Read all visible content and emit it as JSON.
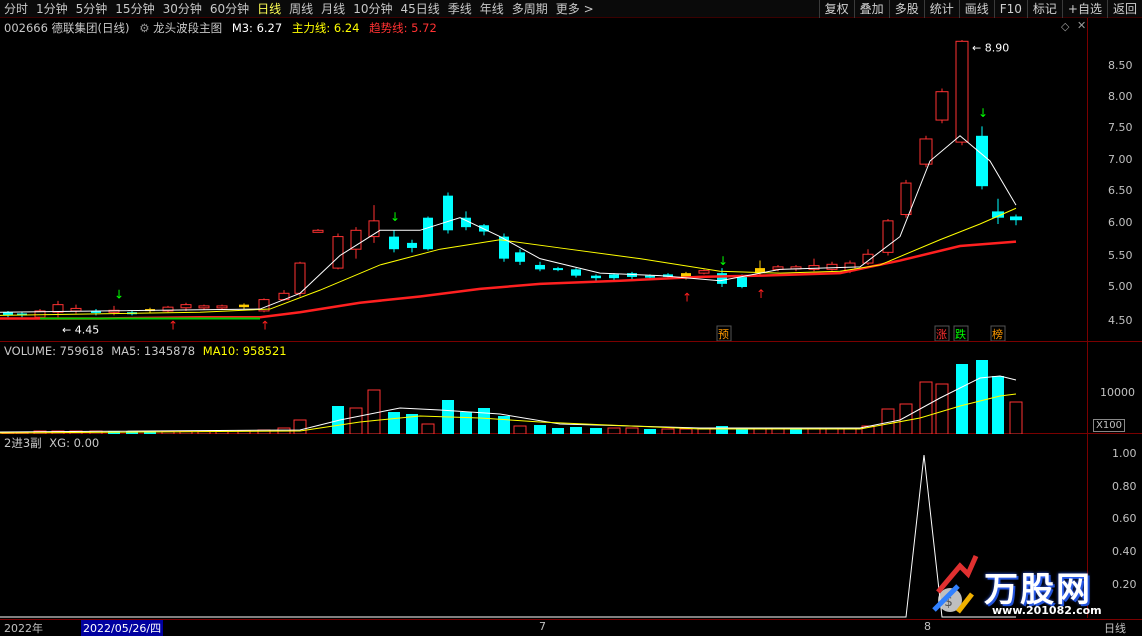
{
  "toolbar": {
    "tabs": [
      "分时",
      "1分钟",
      "5分钟",
      "15分钟",
      "30分钟",
      "60分钟",
      "日线",
      "周线",
      "月线",
      "10分钟",
      "45日线",
      "季线",
      "年线",
      "多周期",
      "更多 >"
    ],
    "active_tab": "日线",
    "right_buttons": [
      "复权",
      "叠加",
      "多股",
      "统计",
      "画线",
      "F10",
      "标记",
      "+自选",
      "返回"
    ]
  },
  "main_pane": {
    "stock": "002666 德联集团(日线)",
    "indicator": "龙头波段主图",
    "m3": "M3: 6.27",
    "main_line": "主力线: 6.24",
    "trend_line": "趋势线: 5.72",
    "high_label": "8.90",
    "low_label": "4.45",
    "y_ticks": [
      "8.50",
      "8.00",
      "7.50",
      "7.00",
      "6.50",
      "6.00",
      "5.50",
      "5.00",
      "4.50"
    ],
    "markers": {
      "yu": "预",
      "zhang": "涨",
      "die": "跌",
      "bang": "榜"
    }
  },
  "volume_pane": {
    "volume": "VOLUME: 759618",
    "ma5": "MA5: 1345878",
    "ma10": "MA10: 958521",
    "y_tick": "10000",
    "unit": "X100"
  },
  "sub_pane": {
    "title": "2进3副",
    "xg": "XG: 0.00",
    "y_ticks": [
      "1.00",
      "0.80",
      "0.60",
      "0.40",
      "0.20"
    ]
  },
  "bottom": {
    "year": "2022年",
    "date": "2022/05/26/四",
    "month7": "7",
    "month8": "8",
    "period": "日线"
  },
  "watermark": {
    "brand": "万股网",
    "url": "www.201082.com"
  },
  "colors": {
    "up": "#ff3232",
    "down": "#00ffff",
    "ma_white": "#ffffff",
    "ma_yellow": "#ffff00",
    "trend_red": "#ff2020",
    "green_line": "#00d000"
  }
}
